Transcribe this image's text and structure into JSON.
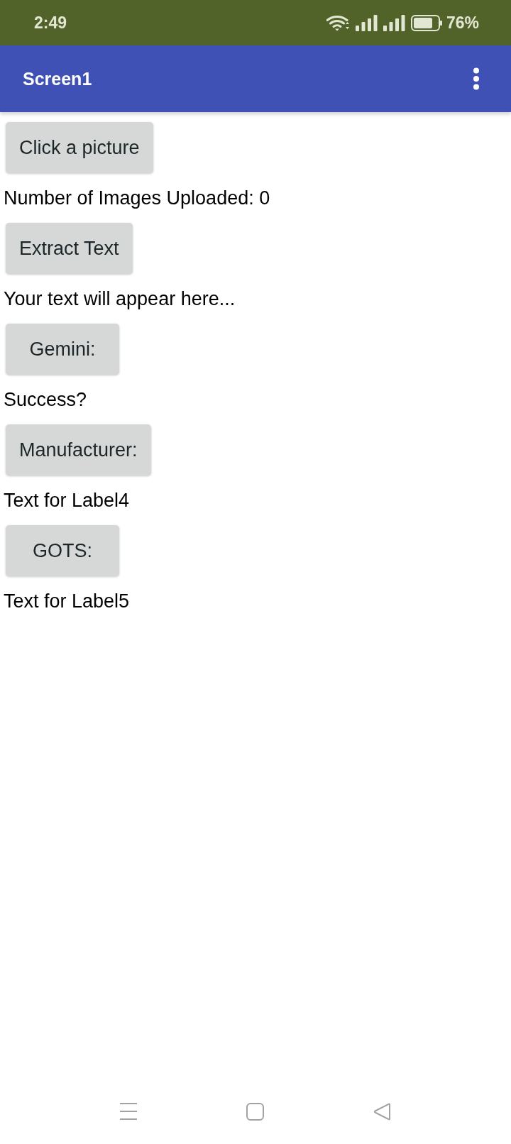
{
  "status_bar": {
    "time": "2:49",
    "battery": "76%"
  },
  "app_bar": {
    "title": "Screen1"
  },
  "content": [
    {
      "kind": "button",
      "text": "Click a picture"
    },
    {
      "kind": "label",
      "text": "Number of Images Uploaded: 0"
    },
    {
      "kind": "button",
      "text": "Extract Text"
    },
    {
      "kind": "label",
      "text": "Your text will appear here..."
    },
    {
      "kind": "button",
      "text": "Gemini:"
    },
    {
      "kind": "label",
      "text": "Success?"
    },
    {
      "kind": "button",
      "text": "Manufacturer:"
    },
    {
      "kind": "label",
      "text": "Text for Label4"
    },
    {
      "kind": "button",
      "text": "GOTS:"
    },
    {
      "kind": "label",
      "text": "Text for Label5"
    }
  ]
}
